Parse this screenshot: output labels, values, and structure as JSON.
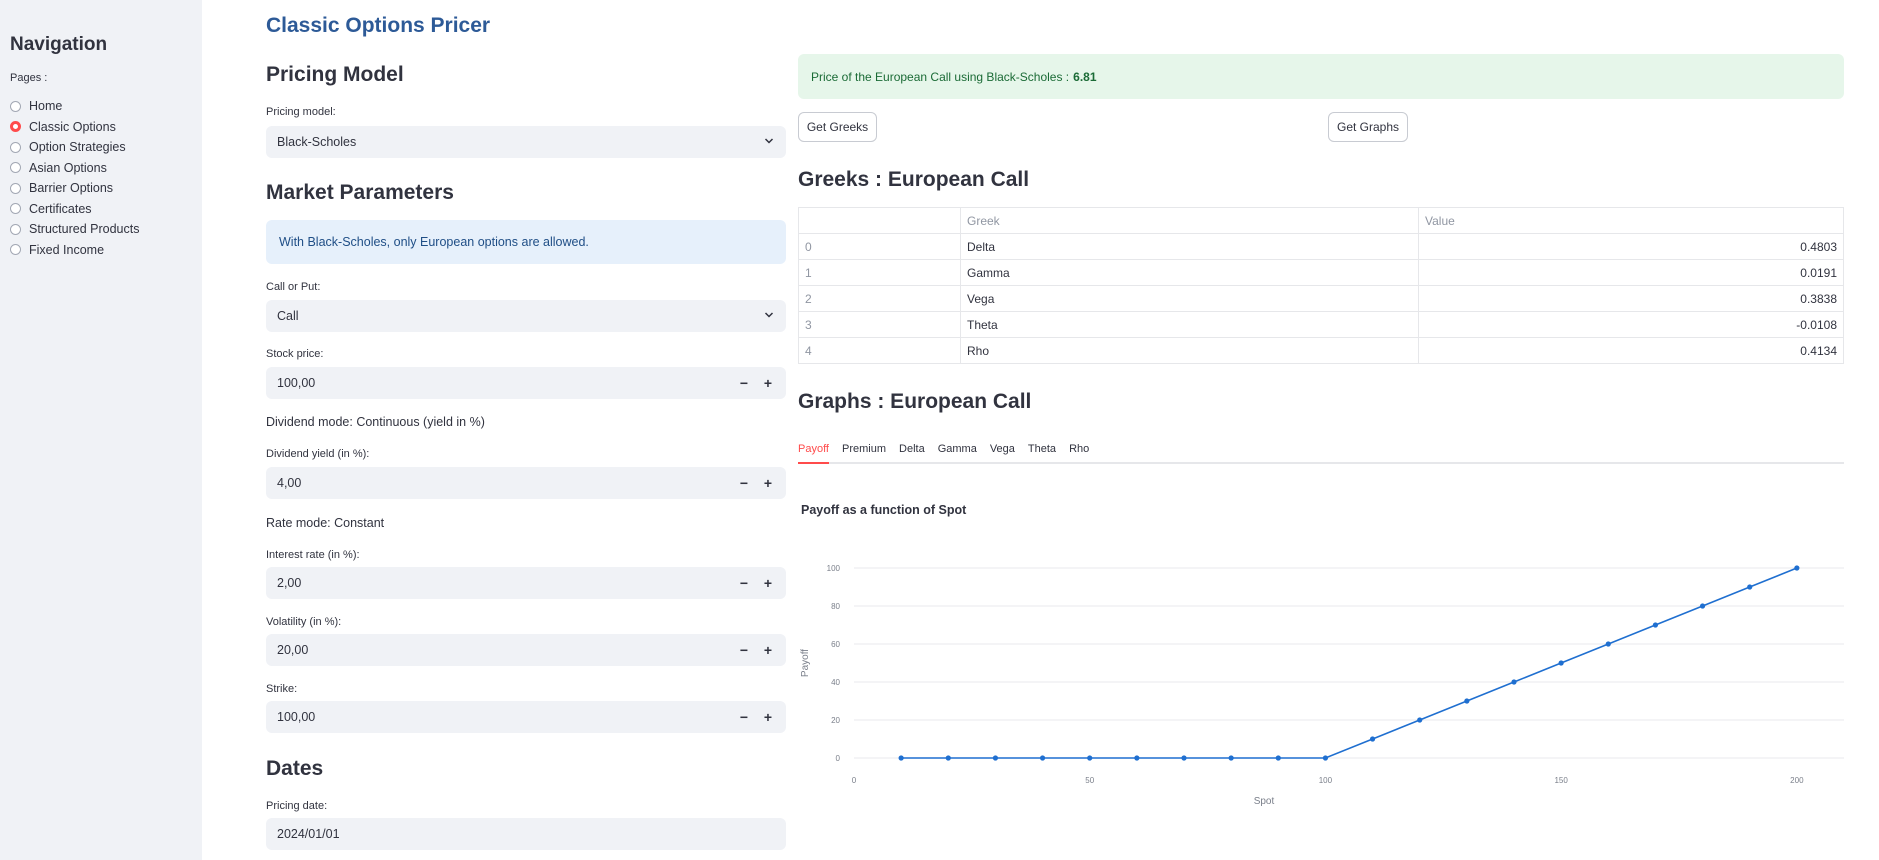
{
  "sidebar": {
    "title": "Navigation",
    "pages_label": "Pages :",
    "pages": [
      "Home",
      "Classic Options",
      "Option Strategies",
      "Asian Options",
      "Barrier Options",
      "Certificates",
      "Structured Products",
      "Fixed Income"
    ],
    "selected_page": "Classic Options"
  },
  "app_title": "Classic Options Pricer",
  "pricing_model": {
    "heading": "Pricing Model",
    "label": "Pricing model:",
    "value": "Black-Scholes"
  },
  "market": {
    "heading": "Market Parameters",
    "info": "With Black-Scholes, only European options are allowed.",
    "call_put_label": "Call or Put:",
    "call_put_value": "Call",
    "stock_label": "Stock price:",
    "stock_value": "100,00",
    "dividend_mode": "Dividend mode: Continuous (yield in %)",
    "dividend_label": "Dividend yield (in %):",
    "dividend_value": "4,00",
    "rate_mode": "Rate mode: Constant",
    "rate_label": "Interest rate (in %):",
    "rate_value": "2,00",
    "vol_label": "Volatility (in %):",
    "vol_value": "20,00",
    "strike_label": "Strike:",
    "strike_value": "100,00",
    "minus": "−",
    "plus": "+"
  },
  "dates": {
    "heading": "Dates",
    "pricing_date_label": "Pricing date:",
    "pricing_date_value": "2024/01/01"
  },
  "result": {
    "text": "Price of the European Call using Black-Scholes :",
    "price": "6.81"
  },
  "buttons": {
    "greeks": "Get Greeks",
    "graphs": "Get Graphs"
  },
  "greeks": {
    "heading": "Greeks : European Call",
    "col_greek": "Greek",
    "col_value": "Value",
    "rows": [
      {
        "idx": "0",
        "name": "Delta",
        "value": "0.4803"
      },
      {
        "idx": "1",
        "name": "Gamma",
        "value": "0.0191"
      },
      {
        "idx": "2",
        "name": "Vega",
        "value": "0.3838"
      },
      {
        "idx": "3",
        "name": "Theta",
        "value": "-0.0108"
      },
      {
        "idx": "4",
        "name": "Rho",
        "value": "0.4134"
      }
    ]
  },
  "graphs": {
    "heading": "Graphs : European Call",
    "tabs": [
      "Payoff",
      "Premium",
      "Delta",
      "Gamma",
      "Vega",
      "Theta",
      "Rho"
    ],
    "active_tab": "Payoff"
  },
  "chart_data": {
    "type": "line",
    "title": "Payoff as a function of Spot",
    "xlabel": "Spot",
    "ylabel": "Payoff",
    "x": [
      10,
      20,
      30,
      40,
      50,
      60,
      70,
      80,
      90,
      100,
      110,
      120,
      130,
      140,
      150,
      160,
      170,
      180,
      190,
      200
    ],
    "series": [
      {
        "values": [
          0,
          0,
          0,
          0,
          0,
          0,
          0,
          0,
          0,
          0,
          10,
          20,
          30,
          40,
          50,
          60,
          70,
          80,
          90,
          100
        ]
      }
    ],
    "xlim": [
      0,
      210
    ],
    "ylim": [
      0,
      100
    ],
    "xticks": [
      0,
      50,
      100,
      150,
      200
    ],
    "yticks": [
      0,
      20,
      40,
      60,
      80,
      100
    ],
    "grid": true,
    "line_color": "#1f6fd0"
  },
  "colors": {
    "accent": "#ff4b4b",
    "title": "#2d5a97",
    "sidebar_bg": "#f0f2f6",
    "success_bg": "#e6f6ea",
    "info_bg": "#e6f0fb"
  }
}
